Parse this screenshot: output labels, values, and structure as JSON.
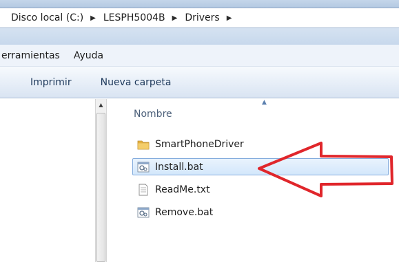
{
  "address": {
    "crumbs": [
      "Disco local (C:)",
      "LESPH5004B",
      "Drivers"
    ],
    "separator_icon": "triangle-right"
  },
  "menu": {
    "tools": "erramientas",
    "help": "Ayuda"
  },
  "toolbar": {
    "print": "Imprimir",
    "new_folder": "Nueva carpeta"
  },
  "list": {
    "column_name": "Nombre",
    "sort_icon": "sort-ascending",
    "items": [
      {
        "name": "SmartPhoneDriver",
        "icon": "folder-icon",
        "selected": false
      },
      {
        "name": "Install.bat",
        "icon": "batch-file-icon",
        "selected": true
      },
      {
        "name": "ReadMe.txt",
        "icon": "text-file-icon",
        "selected": false
      },
      {
        "name": "Remove.bat",
        "icon": "batch-file-icon",
        "selected": false
      }
    ]
  },
  "annotation": {
    "type": "arrow",
    "color": "#e0262b",
    "points_to": "Install.bat"
  },
  "colors": {
    "selection_fill": "#d3e7fb",
    "selection_border": "#84acdd",
    "toolbar_text": "#1e395b",
    "folder": "#e9b542"
  }
}
